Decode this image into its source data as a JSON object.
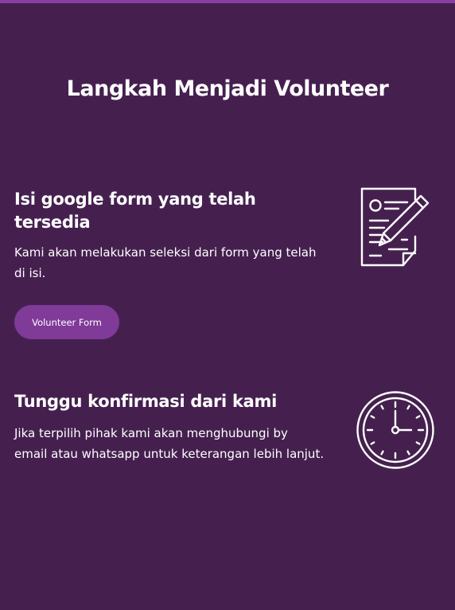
{
  "colors": {
    "background": "#45204f",
    "accent": "#8a3fa0",
    "button": "#803a98",
    "text": "#ffffff"
  },
  "section": {
    "title": "Langkah Menjadi Volunteer"
  },
  "steps": [
    {
      "heading": "Isi google form yang telah tersedia",
      "text": "Kami akan melakukan seleksi dari form yang telah di isi.",
      "button_label": "Volunteer Form",
      "icon": "form-pen-icon"
    },
    {
      "heading": "Tunggu konfirmasi dari kami",
      "text": "Jika terpilih pihak kami akan menghubungi by email atau whatsapp untuk keterangan lebih lanjut.",
      "icon": "clock-icon"
    }
  ]
}
